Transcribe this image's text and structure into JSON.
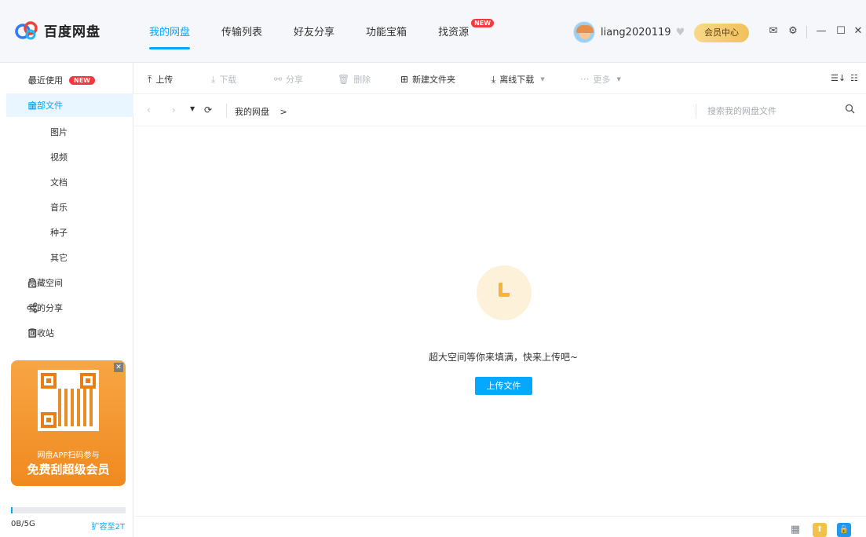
{
  "app": {
    "name": "百度网盘"
  },
  "nav": [
    {
      "label": "我的网盘",
      "active": true
    },
    {
      "label": "传输列表"
    },
    {
      "label": "好友分享"
    },
    {
      "label": "功能宝箱"
    },
    {
      "label": "找资源",
      "badge": "NEW"
    }
  ],
  "user": {
    "name": "liang2020119",
    "vip_label": "会员中心"
  },
  "sidebar": {
    "items": [
      {
        "label": "最近使用",
        "badge": "NEW",
        "icon": "clock-icon"
      },
      {
        "label": "全部文件",
        "active": true,
        "icon": "document-icon"
      },
      {
        "label": "图片"
      },
      {
        "label": "视频"
      },
      {
        "label": "文档"
      },
      {
        "label": "音乐"
      },
      {
        "label": "种子"
      },
      {
        "label": "其它"
      },
      {
        "label": "隐藏空间",
        "icon": "lock-icon"
      },
      {
        "label": "我的分享",
        "icon": "share-icon"
      },
      {
        "label": "回收站",
        "icon": "trash-icon"
      }
    ],
    "promo": {
      "line1": "网盘APP扫码参与",
      "line2": "免费刮超级会员"
    },
    "quota": {
      "used_text": "0B/5G",
      "expand_label": "扩容至2T",
      "used_fraction": 0.01
    }
  },
  "toolbar": {
    "upload": "上传",
    "download": "下载",
    "share": "分享",
    "delete": "删除",
    "new_folder": "新建文件夹",
    "offline_download": "离线下载",
    "more": "更多"
  },
  "path": {
    "root": "我的网盘",
    "sep": ">"
  },
  "search": {
    "placeholder": "搜索我的网盘文件"
  },
  "empty": {
    "message": "超大空间等你来填满，快来上传吧~",
    "button": "上传文件"
  },
  "colors": {
    "accent": "#06a7ff",
    "badge": "#f5383d",
    "vip": "#f1c15b",
    "promo": "#f08a1f"
  }
}
